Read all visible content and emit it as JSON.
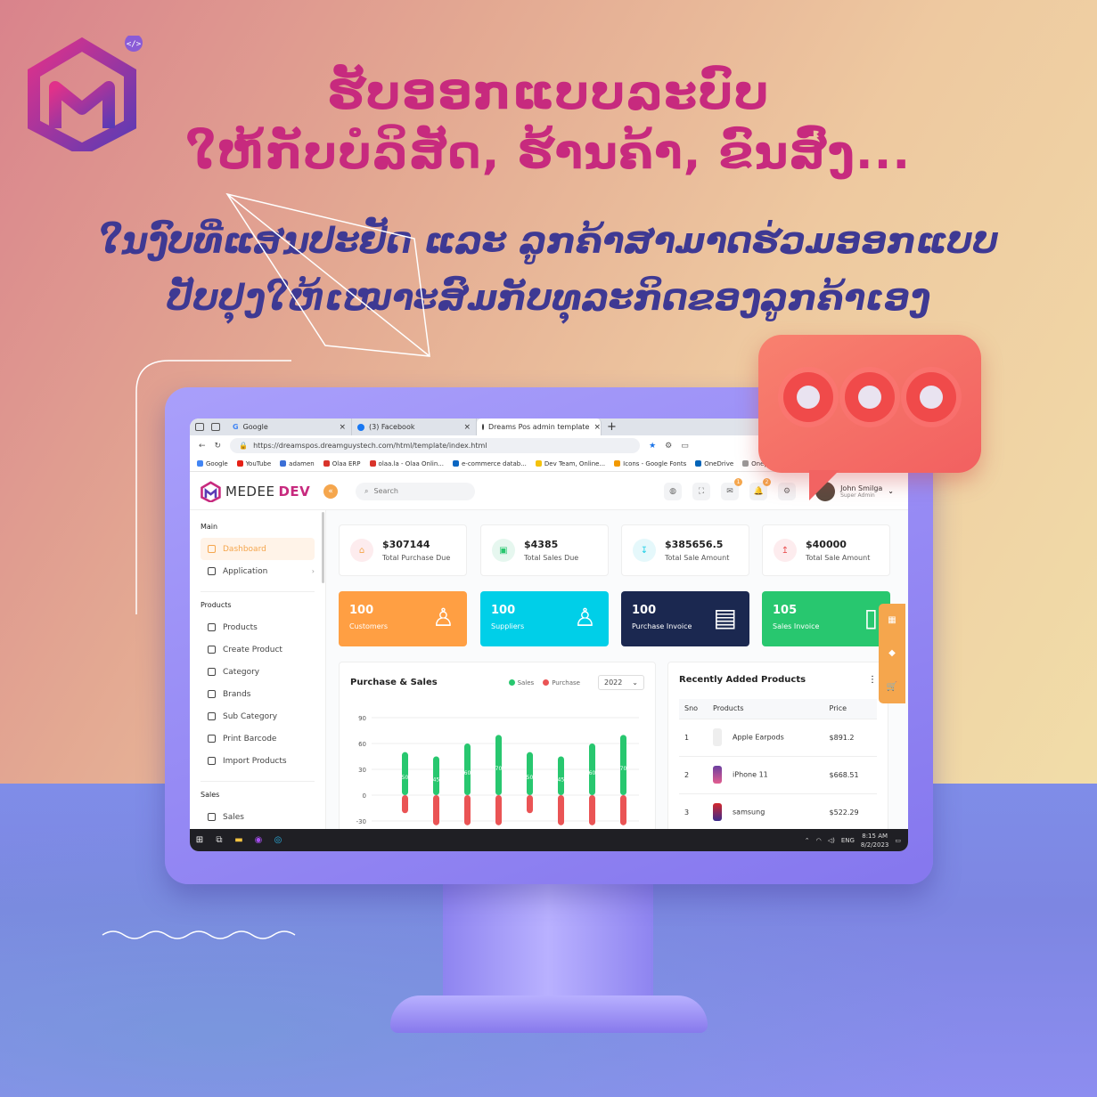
{
  "headline": {
    "line1": "ຮັບອອກແບບລະບົບ",
    "line2": "ໃຫ້ກັບບໍລິສັດ, ຮ້ານຄ້າ, ຂົນສົ່ງ...",
    "line3": "ໃນງົບທີ່ແສນປະຢັດ ແລະ ລູກຄ້າສາມາດຮ່ວມອອກແບບ",
    "line4": "ປັບປຸງໃຫ້ເໝາະສົມກັບທຸລະກິດຂອງລູກຄ້າເອງ"
  },
  "colors": {
    "accent": "#c72a7e",
    "subtext": "#3e3993",
    "orange": "#f5a64d",
    "cyan": "#1dcee6",
    "navy": "#1b2850",
    "green": "#28c76f"
  },
  "browser": {
    "tabs": [
      {
        "label": "Google",
        "icon": "google-icon"
      },
      {
        "label": "(3) Facebook",
        "icon": "facebook-icon"
      },
      {
        "label": "Dreams Pos admin template",
        "icon": "page-icon"
      }
    ],
    "url": "https://dreamspos.dreamguystech.com/html/template/index.html",
    "bookmarks": [
      "Google",
      "YouTube",
      "adamen",
      "Olaa ERP",
      "olaa.la - Olaa Onlin...",
      "e-commerce datab...",
      "Dev Team, Online...",
      "Icons - Google Fonts",
      "OneDrive",
      "Onep"
    ]
  },
  "app": {
    "brand_plain": "MEDEE",
    "brand_accent": "DEV",
    "search_placeholder": "Search",
    "notifications": {
      "mail": "1",
      "bell": "2"
    },
    "user": {
      "name": "John Smilga",
      "role": "Super Admin"
    }
  },
  "sidebar": {
    "main_label": "Main",
    "main_items": [
      {
        "label": "Dashboard"
      },
      {
        "label": "Application"
      }
    ],
    "products_label": "Products",
    "product_items": [
      {
        "label": "Products"
      },
      {
        "label": "Create Product"
      },
      {
        "label": "Category"
      },
      {
        "label": "Brands"
      },
      {
        "label": "Sub Category"
      },
      {
        "label": "Print Barcode"
      },
      {
        "label": "Import Products"
      }
    ],
    "sales_label": "Sales",
    "sales_items": [
      {
        "label": "Sales"
      }
    ]
  },
  "stats": [
    {
      "value": "$307144",
      "label": "Total Purchase Due"
    },
    {
      "value": "$4385",
      "label": "Total Sales Due"
    },
    {
      "value": "$385656.5",
      "label": "Total Sale Amount"
    },
    {
      "value": "$40000",
      "label": "Total Sale Amount"
    }
  ],
  "counts": [
    {
      "value": "100",
      "label": "Customers"
    },
    {
      "value": "100",
      "label": "Suppliers"
    },
    {
      "value": "100",
      "label": "Purchase Invoice"
    },
    {
      "value": "105",
      "label": "Sales Invoice"
    }
  ],
  "purchase_sales": {
    "title": "Purchase & Sales",
    "legend_sales": "Sales",
    "legend_purchase": "Purchase",
    "year": "2022"
  },
  "chart_data": {
    "type": "bar",
    "title": "Purchase & Sales",
    "categories": [
      "",
      "",
      "",
      "",
      "",
      "",
      "",
      ""
    ],
    "yticks": [
      "90",
      "60",
      "30",
      "0",
      "-30"
    ],
    "ylim": [
      -30,
      90
    ],
    "series": [
      {
        "name": "Sales",
        "values": [
          50,
          45,
          60,
          70,
          50,
          45,
          60,
          70
        ],
        "color": "#28c76f"
      },
      {
        "name": "Purchase",
        "values": [
          -21,
          -35,
          -35,
          -35,
          -21,
          -35,
          -35,
          -35
        ],
        "color": "#ea5455"
      }
    ],
    "data_labels": [
      "50",
      "45",
      "60",
      "70",
      "50",
      "45",
      "60",
      "70"
    ]
  },
  "recent_products": {
    "title": "Recently Added Products",
    "columns": [
      "Sno",
      "Products",
      "Price"
    ],
    "rows": [
      {
        "sno": "1",
        "name": "Apple Earpods",
        "price": "$891.2"
      },
      {
        "sno": "2",
        "name": "iPhone 11",
        "price": "$668.51"
      },
      {
        "sno": "3",
        "name": "samsung",
        "price": "$522.29"
      }
    ]
  },
  "taskbar": {
    "time": "8:15 AM",
    "date": "8/2/2023",
    "lang": "ENG"
  }
}
